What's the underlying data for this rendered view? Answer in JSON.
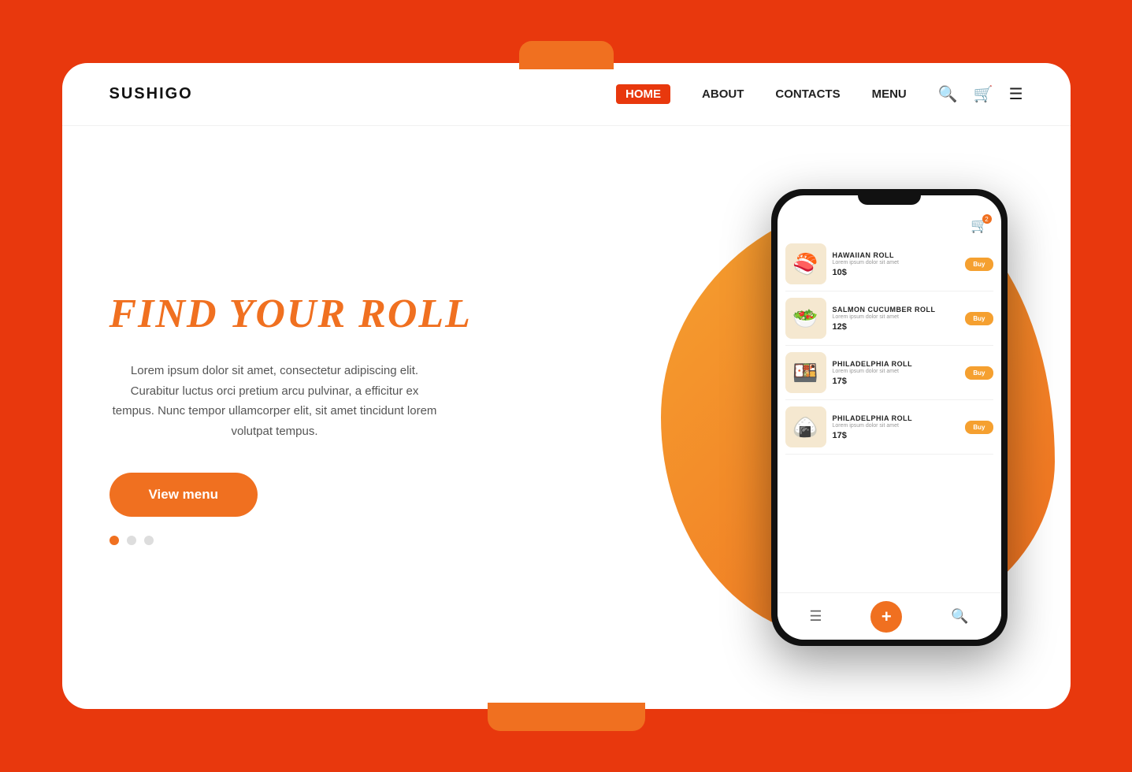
{
  "page": {
    "background_color": "#e8380d",
    "card_background": "#ffffff"
  },
  "navbar": {
    "logo": "SUSHIGO",
    "links": [
      {
        "label": "HOME",
        "active": true
      },
      {
        "label": "ABOUT",
        "active": false
      },
      {
        "label": "CONTACTS",
        "active": false
      },
      {
        "label": "MENU",
        "active": false
      }
    ],
    "icons": [
      "search",
      "cart",
      "menu"
    ]
  },
  "hero": {
    "title": "FIND YOUR ROLL",
    "description": "Lorem ipsum dolor sit amet, consectetur adipiscing elit. Curabitur luctus orci pretium arcu pulvinar, a efficitur ex tempus. Nunc tempor ullamcorper elit, sit amet tincidunt lorem volutpat tempus.",
    "cta_button": "View menu",
    "dots": [
      {
        "active": true
      },
      {
        "active": false
      },
      {
        "active": false
      }
    ]
  },
  "phone": {
    "items": [
      {
        "name": "HAWAIIAN ROLL",
        "description": "Lorem ipsum dolor sit amet",
        "price": "10$",
        "emoji": "🍣",
        "buy_label": "Buy"
      },
      {
        "name": "SALMON CUCUMBER ROLL",
        "description": "Lorem ipsum dolor sit amet",
        "price": "12$",
        "emoji": "🥗",
        "buy_label": "Buy"
      },
      {
        "name": "PHILADELPHIA ROLL",
        "description": "Lorem ipsum dolor sit amet",
        "price": "17$",
        "emoji": "🍱",
        "buy_label": "Buy"
      },
      {
        "name": "PHILADELPHIA ROLL",
        "description": "Lorem ipsum dolor sit amet",
        "price": "17$",
        "emoji": "🍙",
        "buy_label": "Buy"
      }
    ],
    "bottom_nav": {
      "menu_icon": "☰",
      "plus_icon": "+",
      "search_icon": "🔍"
    }
  }
}
